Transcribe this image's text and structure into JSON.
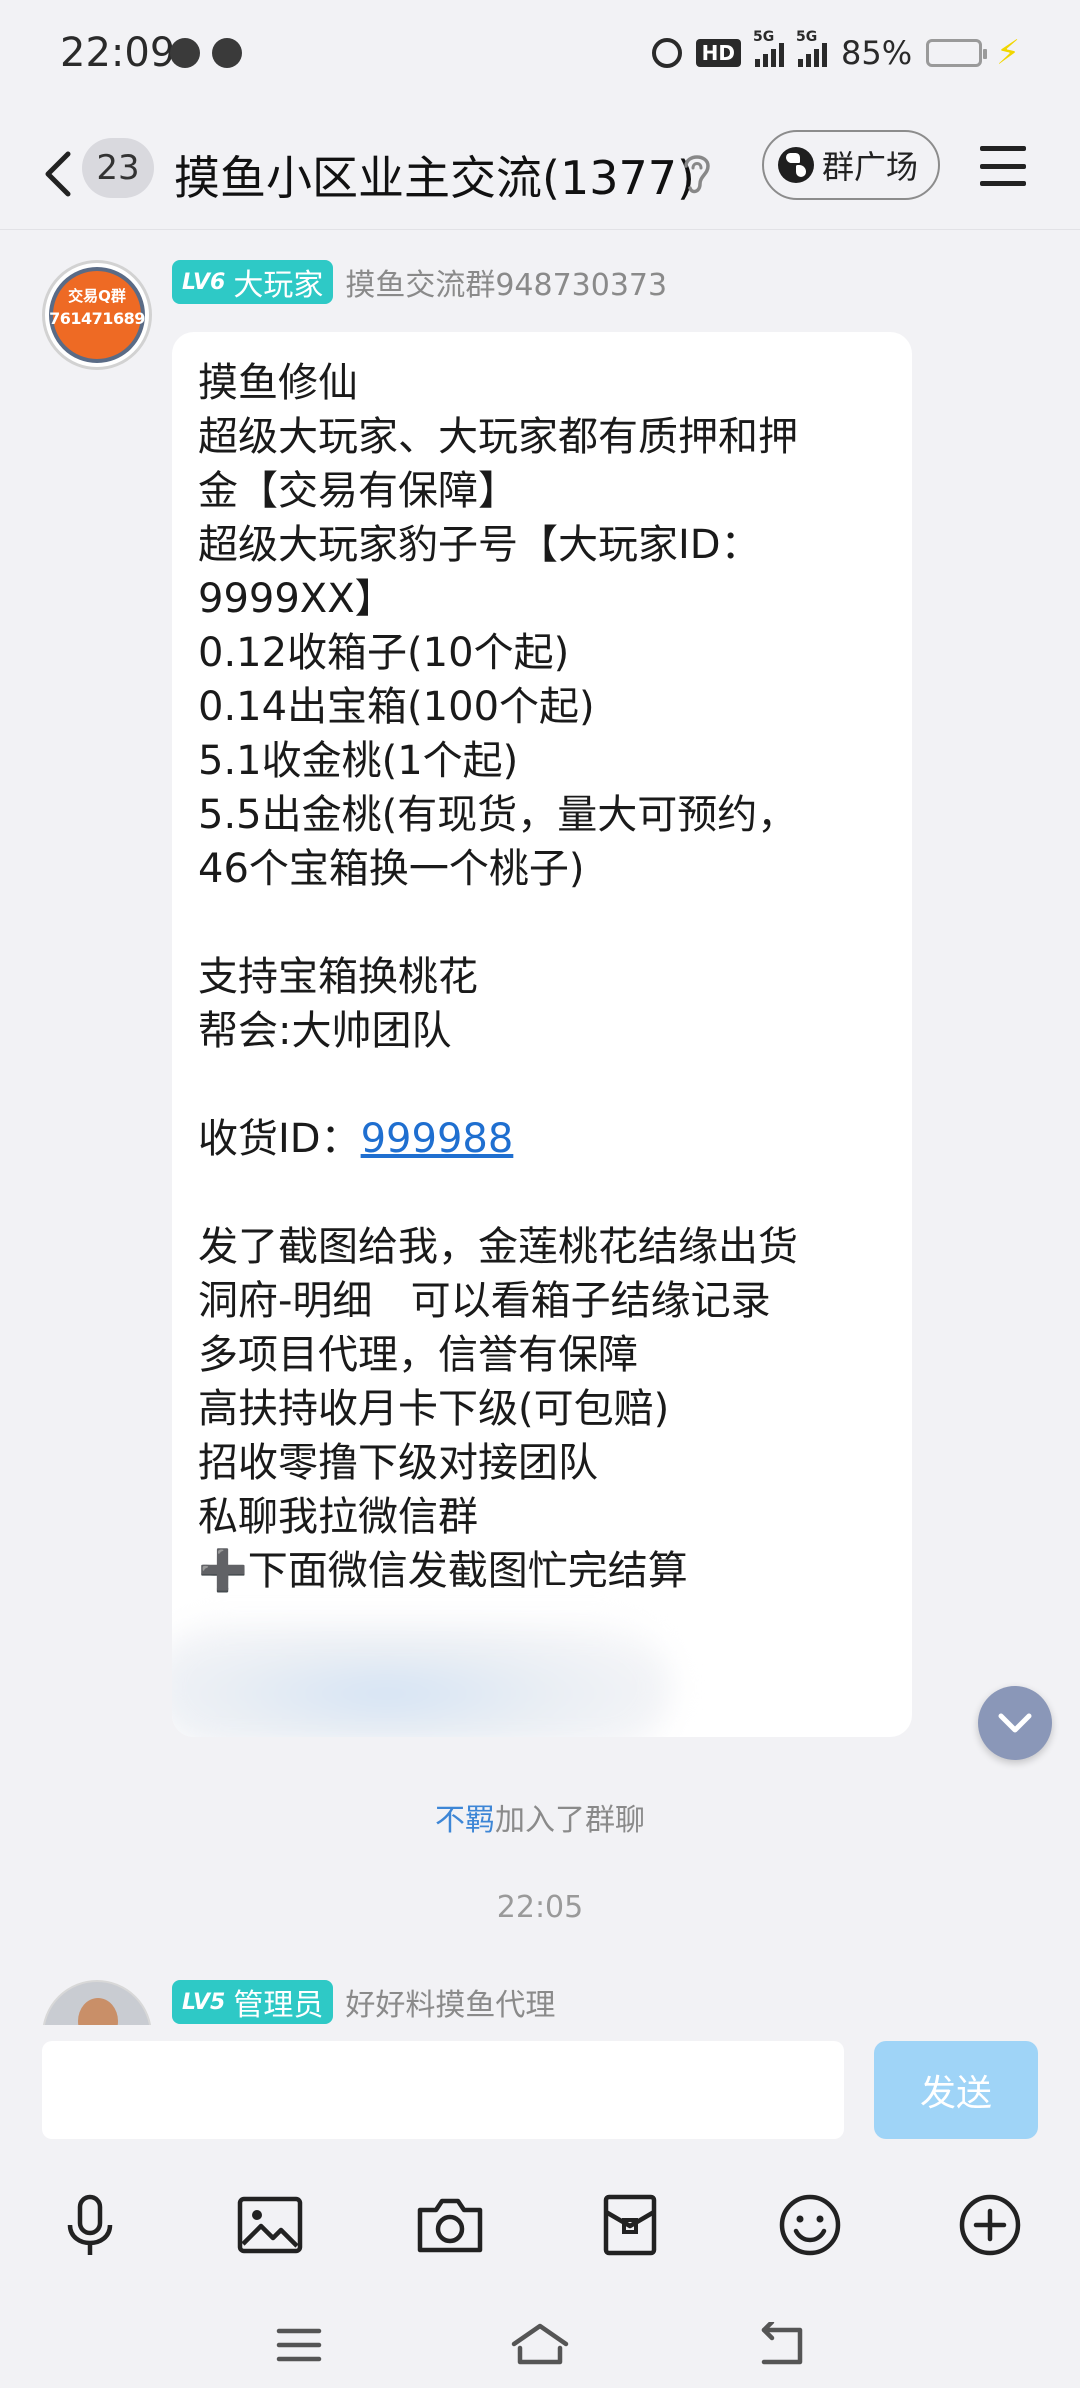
{
  "status_bar": {
    "time": "22:09",
    "hd": "HD",
    "sim1_label": "5G",
    "sim2_label": "5G",
    "battery": "85%",
    "battery_level": 0.85,
    "icons": [
      "wechat-icon",
      "message-icon",
      "alarm-icon",
      "hd-icon",
      "signal-icon",
      "signal-icon",
      "battery-icon",
      "charging-icon"
    ]
  },
  "header": {
    "unread_count": "23",
    "title": "摸鱼小区业主交流(1377)",
    "square_label": "群广场",
    "icons": [
      "back-icon",
      "ear-icon",
      "globe-icon",
      "menu-icon"
    ]
  },
  "messages": [
    {
      "avatar_text_top": "交易Q群",
      "avatar_text_bottom": "761471689",
      "level": "LV6",
      "title": "大玩家",
      "sender": "摸鱼交流群948730373",
      "lines": [
        "摸鱼修仙",
        "超级大玩家、大玩家都有质押和押",
        "金【交易有保障】",
        "超级大玩家豹子号【大玩家ID：",
        "9999XX】",
        "0.12收箱子(10个起)",
        "0.14出宝箱(100个起)",
        "5.1收金桃(1个起)",
        "5.5出金桃(有现货，量大可预约，",
        "46个宝箱换一个桃子)",
        "",
        "支持宝箱换桃花",
        "帮会:大帅团队",
        ""
      ],
      "id_label": "收货ID：",
      "id_value": "999988",
      "lines_after": [
        "",
        "发了截图给我，金莲桃花结缘出货",
        "洞府-明细   可以看箱子结缘记录",
        "多项目代理，信誉有保障",
        "高扶持收月卡下级(可包赔)",
        "招收零撸下级对接团队",
        "私聊我拉微信群",
        "➕下面微信发截图忙完结算"
      ]
    }
  ],
  "system_notice": {
    "name": "不羁",
    "text": "加入了群聊"
  },
  "timestamp": "22:05",
  "next_message": {
    "level": "LV5",
    "title": "管理员",
    "sender": "好好料摸鱼代理"
  },
  "input": {
    "placeholder": "",
    "send_label": "发送"
  },
  "toolbar_icons": [
    "microphone-icon",
    "image-icon",
    "camera-icon",
    "red-packet-icon",
    "emoji-icon",
    "plus-icon"
  ],
  "nav_icons": [
    "menu-nav-icon",
    "home-nav-icon",
    "back-nav-icon"
  ],
  "colors": {
    "accent_link": "#1f6fd0",
    "level_tag": "#2ec9c6",
    "send_button": "#9fd4f7",
    "background": "#f2f2f5"
  }
}
